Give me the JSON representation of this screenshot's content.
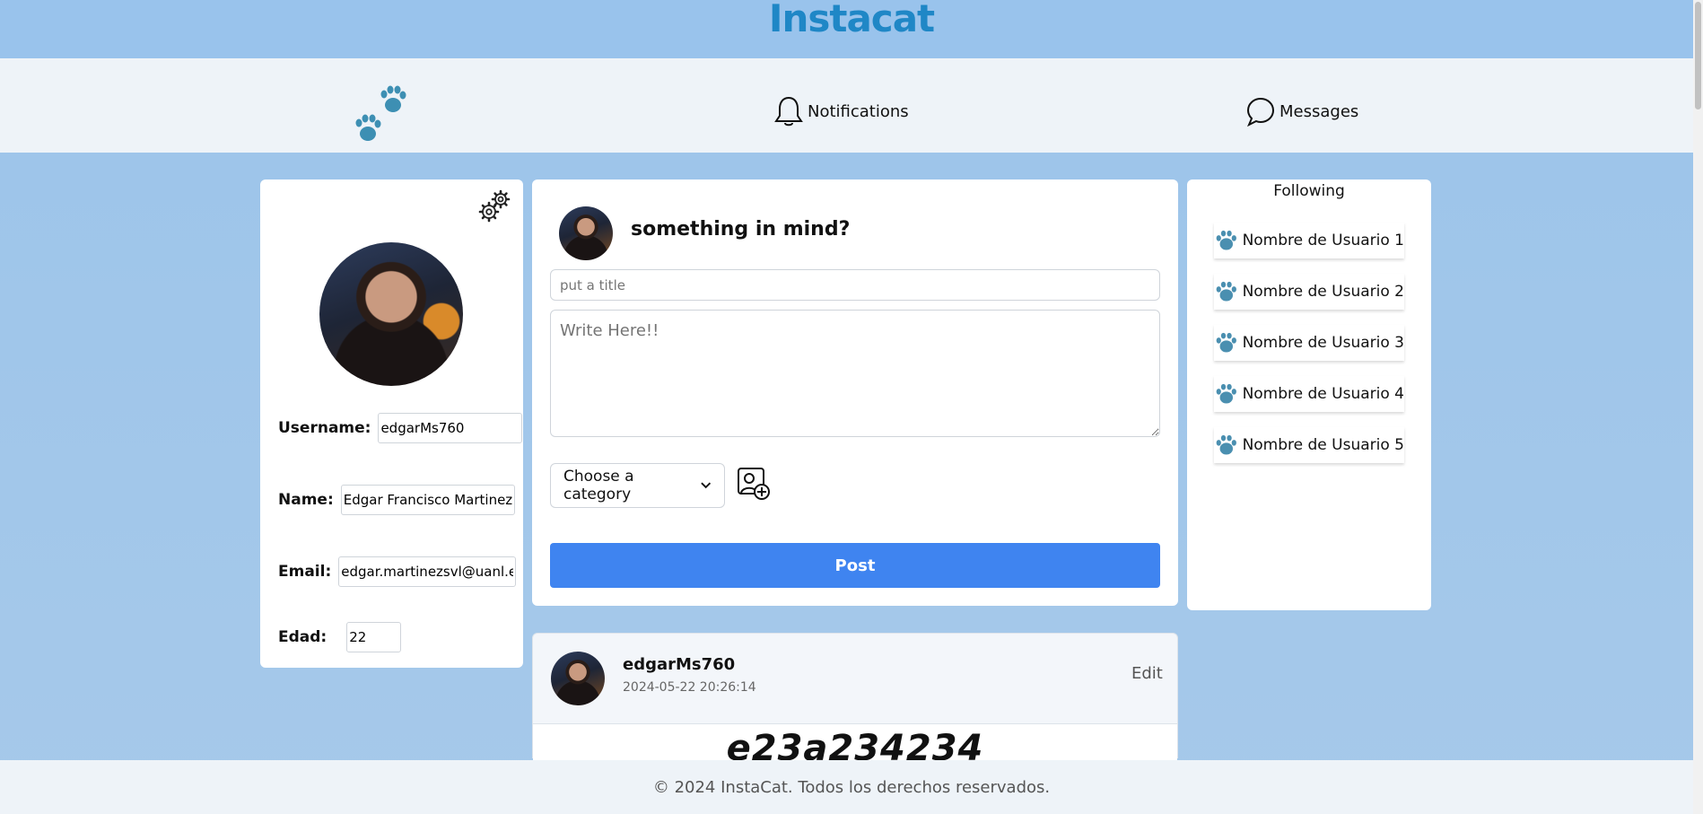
{
  "header": {
    "brand": "Instacat"
  },
  "nav": {
    "logo_icon": "paw-prints-icon",
    "notifications_label": "Notifications",
    "messages_label": "Messages"
  },
  "profile": {
    "settings_icon": "gears-icon",
    "fields": {
      "username_label": "Username:",
      "username_value": "edgarMs760",
      "name_label": "Name:",
      "name_value": "Edgar Francisco Martinez So",
      "email_label": "Email:",
      "email_value": "edgar.martinezsvl@uanl.edu.",
      "age_label": "Edad:",
      "age_value": "22"
    }
  },
  "compose": {
    "prompt": "something in mind?",
    "title_placeholder": "put a title",
    "body_placeholder": "Write Here!!",
    "category_label": "Choose a category",
    "post_button": "Post"
  },
  "following": {
    "title": "Following",
    "users": [
      "Nombre de Usuario 1",
      "Nombre de Usuario 2",
      "Nombre de Usuario 3",
      "Nombre de Usuario 4",
      "Nombre de Usuario 5"
    ]
  },
  "post": {
    "username": "edgarMs760",
    "timestamp": "2024-05-22 20:26:14",
    "edit_label": "Edit",
    "title": "e23a234234"
  },
  "footer": {
    "text": "© 2024 InstaCat. Todos los derechos reservados."
  },
  "colors": {
    "header_bg": "#99c3ec",
    "brand": "#1f87c6",
    "primary_button": "#3f84f0",
    "paw": "#4a8fb0"
  }
}
